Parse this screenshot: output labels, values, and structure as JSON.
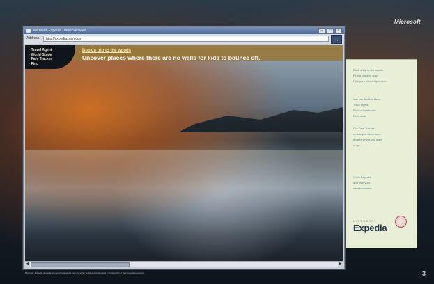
{
  "ad": {
    "logo": "Microsoft",
    "page_number": "3",
    "fine_print": "Microsoft, Expedia, Expedia.com and the Expedia logo are either registered trademarks or trademarks of their respective owners."
  },
  "browser": {
    "title": "Microsoft Expedia Travel Services",
    "address_label": "Address",
    "address_value": "http://expedia.msn.com",
    "go_label": "→"
  },
  "site": {
    "nav": [
      "Travel Agent",
      "World Guide",
      "Fare Tracker",
      "Find"
    ],
    "link": "Book a trip to the woods",
    "headline": "Uncover places where there are no walls for kids to bounce off."
  },
  "panel": {
    "lines": [
      "Book a trip to the woods.",
      "Find a place to stay.",
      "Plan your whole trip online.",
      "",
      "You can find low fares.",
      "Track flights.",
      "Book a hotel room.",
      "Rent a car.",
      "",
      "Our Fare Tracker",
      "emails you when fares",
      "drop to where you want",
      "to go.",
      "",
      "Go to Expedia",
      "and plan your",
      "vacation online."
    ],
    "brand_small": "MICROSOFT",
    "brand": "Expedia"
  }
}
